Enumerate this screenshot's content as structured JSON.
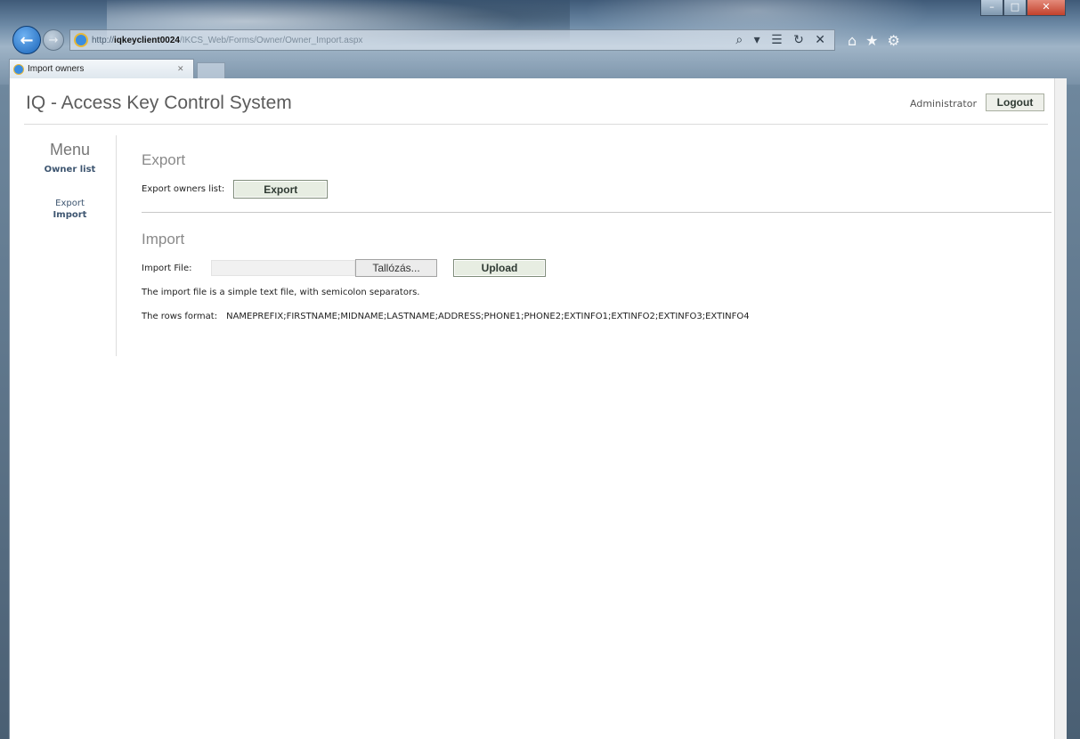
{
  "browser": {
    "url_scheme": "http://",
    "url_host": "iqkeyclient0024",
    "url_path": "/IKCS_Web/Forms/Owner/Owner_Import.aspx",
    "address_actions": "⌕ ▾ ☰ ↻ ✕",
    "tool_icons": "⌂★⚙",
    "tab_title": "Import owners",
    "tab_close": "✕",
    "window_buttons": [
      "–",
      "□",
      "✕"
    ]
  },
  "header": {
    "app_title": "IQ - Access Key Control System",
    "user": "Administrator",
    "logout_label": "Logout"
  },
  "sidebar": {
    "title": "Menu",
    "owner_list": "Owner list",
    "export_label": "Export",
    "import_label": "Import"
  },
  "export_section": {
    "title": "Export",
    "label": "Export owners list:",
    "button": "Export"
  },
  "import_section": {
    "title": "Import",
    "file_label": "Import File:",
    "browse_button": "Tallózás...",
    "upload_button": "Upload",
    "info_line": "The import file is a simple text file, with semicolon separators.",
    "format_label": "The rows format:",
    "format_value": "NAMEPREFIX;FIRSTNAME;MIDNAME;LASTNAME;ADDRESS;PHONE1;PHONE2;EXTINFO1;EXTINFO2;EXTINFO3;EXTINFO4"
  }
}
